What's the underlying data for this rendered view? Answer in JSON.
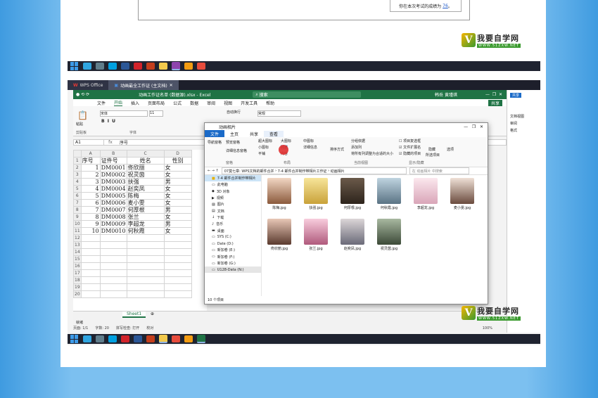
{
  "top_screenshot": {
    "score_prefix": "你在本次考试的成绩为",
    "score_value": "76",
    "score_suffix": "。"
  },
  "logo": {
    "mark": "V",
    "name": "我要自学网",
    "url": "WWW.51ZXW.NET"
  },
  "excel": {
    "tabs": [
      {
        "label": "WPS Office"
      },
      {
        "label": "动画最全工作证 (主文档)"
      }
    ],
    "window_title": "动画工作证名单 (数据源).xlsx - Excel",
    "search_placeholder": "搜索",
    "user": "韩岳 黄瑾琪",
    "menu": [
      "文件",
      "开始",
      "插入",
      "页面布局",
      "公式",
      "数据",
      "审阅",
      "视图",
      "开发工具",
      "帮助"
    ],
    "share": "共享",
    "ribbon": {
      "font": "宋体",
      "size": "11",
      "wrap": "自动换行",
      "format": "常规",
      "paste": "粘贴",
      "groups": [
        "剪贴板",
        "字体"
      ]
    },
    "namebox": "A1",
    "formula": "序号",
    "fx": "fx",
    "columns": [
      "A",
      "B",
      "C",
      "D"
    ],
    "headers": [
      "序号",
      "证件号",
      "姓名",
      "性别"
    ],
    "rows": [
      [
        "1",
        "DM0001",
        "佟欣丽",
        "女"
      ],
      [
        "2",
        "DM0002",
        "祝灵茵",
        "女"
      ],
      [
        "3",
        "DM0003",
        "扶强",
        "男"
      ],
      [
        "4",
        "DM0004",
        "赵奕凤",
        "女"
      ],
      [
        "5",
        "DM0005",
        "陈梅",
        "女"
      ],
      [
        "6",
        "DM0006",
        "麦小雯",
        "女"
      ],
      [
        "7",
        "DM0007",
        "何厚根",
        "男"
      ],
      [
        "8",
        "DM0008",
        "张兰",
        "女"
      ],
      [
        "9",
        "DM0009",
        "李超龙",
        "男"
      ],
      [
        "10",
        "DM0010",
        "何秋霞",
        "女"
      ]
    ],
    "sheet_tab": "Sheet1",
    "status": {
      "ready": "就绪",
      "page": "页面: 1/1",
      "chars": "字数: 20",
      "spell": "拼写检查: 打开",
      "proof": "校对",
      "zoom": "100%"
    },
    "right_panel": [
      "共享",
      "文档视图",
      "审阅",
      "格式"
    ]
  },
  "explorer": {
    "title": "动画相片",
    "tabs": [
      "文件",
      "主页",
      "共享",
      "查看"
    ],
    "ribbon": {
      "pane": "导航窗格",
      "preview": "预览窗格",
      "details_pane": "详细信息窗格",
      "group_pane": "窗格",
      "large": "超大图标",
      "big": "大图标",
      "medium": "中图标",
      "small": "小图标",
      "list": "列表",
      "detail": "详细信息",
      "tile": "平铺",
      "content": "内容",
      "group_layout": "布局",
      "sort": "排序方式",
      "group_by": "分组依据",
      "add_col": "添加列",
      "fit_cols": "将所有列调整为合适的大小",
      "group_view": "当前视图",
      "checkbox": "项目复选框",
      "ext": "文件扩展名",
      "hidden": "隐藏的项目",
      "hide": "隐藏",
      "hide_sel": "所选项目",
      "group_show": "显示/隐藏",
      "options": "选项"
    },
    "path": [
      "07莫七章: WPS文档的邮件合并",
      "7-4 邮件合并制作带相片工作证",
      "动画相片"
    ],
    "search": "在 动画相片 中搜索",
    "nav": [
      "7-4 邮件合并制作带相片",
      "此电脑",
      "3D 对象",
      "视频",
      "图片",
      "文档",
      "下载",
      "音乐",
      "桌面",
      "SYS (C:)",
      "Date (D:)",
      "新加卷 (E:)",
      "新加卷 (F:)",
      "新加卷 (G:)",
      "U128-Data (N:)"
    ],
    "files": [
      "陈梅.jpg",
      "扶强.jpg",
      "何厚根.jpg",
      "何秋霞.jpg",
      "李超龙.jpg",
      "麦小雯.jpg",
      "佟欣丽.jpg",
      "张兰.jpg",
      "赵奕凤.jpg",
      "祝灵茵.jpg"
    ],
    "status": "10 个项目"
  },
  "colors": {
    "excel_green": "#1f7345",
    "taskbar": "#1f2330",
    "bg_blue": "#7cc0f0"
  }
}
